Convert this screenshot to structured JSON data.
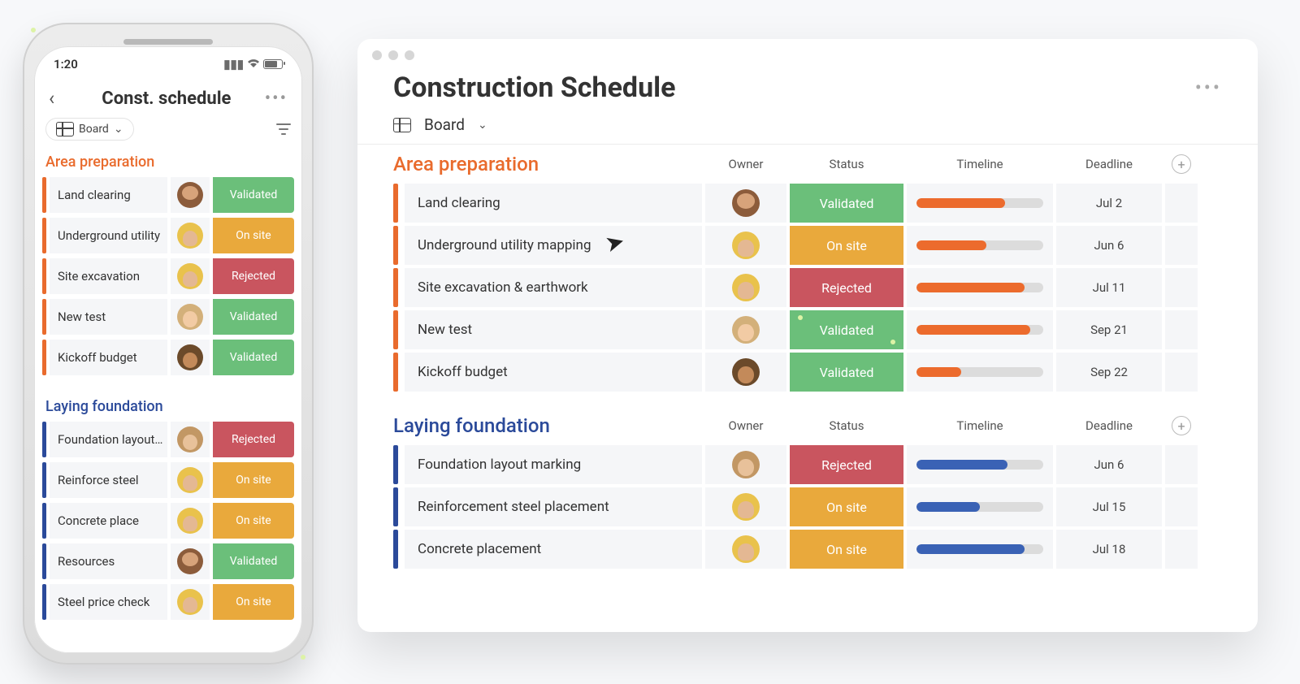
{
  "phone": {
    "time": "1:20",
    "header": {
      "title": "Const. schedule"
    },
    "view_chip": "Board",
    "groups": [
      {
        "title": "Area preparation",
        "color": "orange",
        "rows": [
          {
            "name": "Land clearing",
            "avatar": "av-1",
            "status": "Validated",
            "status_class": "st-validated"
          },
          {
            "name": "Underground utility",
            "avatar": "av-2",
            "status": "On site",
            "status_class": "st-onsite"
          },
          {
            "name": "Site excavation",
            "avatar": "av-2",
            "status": "Rejected",
            "status_class": "st-rejected"
          },
          {
            "name": "New test",
            "avatar": "av-3",
            "status": "Validated",
            "status_class": "st-validated",
            "confetti": true
          },
          {
            "name": "Kickoff budget",
            "avatar": "av-4",
            "status": "Validated",
            "status_class": "st-validated"
          }
        ]
      },
      {
        "title": "Laying foundation",
        "color": "navy",
        "rows": [
          {
            "name": "Foundation layout…",
            "avatar": "av-5",
            "status": "Rejected",
            "status_class": "st-rejected"
          },
          {
            "name": "Reinforce steel",
            "avatar": "av-2",
            "status": "On site",
            "status_class": "st-onsite"
          },
          {
            "name": "Concrete place",
            "avatar": "av-2",
            "status": "On site",
            "status_class": "st-onsite"
          },
          {
            "name": "Resources",
            "avatar": "av-1",
            "status": "Validated",
            "status_class": "st-validated"
          },
          {
            "name": "Steel price check",
            "avatar": "av-2",
            "status": "On site",
            "status_class": "st-onsite"
          }
        ]
      }
    ]
  },
  "desktop": {
    "title": "Construction Schedule",
    "view_label": "Board",
    "columns": {
      "owner": "Owner",
      "status": "Status",
      "timeline": "Timeline",
      "deadline": "Deadline"
    },
    "groups": [
      {
        "title": "Area preparation",
        "color": "orange",
        "rows": [
          {
            "name": "Land clearing",
            "avatar": "av-1",
            "status": "Validated",
            "status_class": "st-validated",
            "progress": 70,
            "fill": "orange",
            "deadline": "Jul 2"
          },
          {
            "name": "Underground utility mapping",
            "avatar": "av-2",
            "status": "On site",
            "status_class": "st-onsite",
            "progress": 55,
            "fill": "orange",
            "deadline": "Jun 6"
          },
          {
            "name": "Site excavation & earthwork",
            "avatar": "av-2",
            "status": "Rejected",
            "status_class": "st-rejected",
            "progress": 85,
            "fill": "orange",
            "deadline": "Jul 11"
          },
          {
            "name": "New test",
            "avatar": "av-3",
            "status": "Validated",
            "status_class": "st-validated",
            "progress": 90,
            "fill": "orange",
            "deadline": "Sep 21",
            "confetti": true
          },
          {
            "name": "Kickoff budget",
            "avatar": "av-4",
            "status": "Validated",
            "status_class": "st-validated",
            "progress": 35,
            "fill": "orange",
            "deadline": "Sep 22"
          }
        ]
      },
      {
        "title": "Laying foundation",
        "color": "navy",
        "rows": [
          {
            "name": "Foundation layout marking",
            "avatar": "av-5",
            "status": "Rejected",
            "status_class": "st-rejected",
            "progress": 72,
            "fill": "navy",
            "deadline": "Jun 6"
          },
          {
            "name": "Reinforcement steel placement",
            "avatar": "av-2",
            "status": "On site",
            "status_class": "st-onsite",
            "progress": 50,
            "fill": "navy",
            "deadline": "Jul 15"
          },
          {
            "name": "Concrete placement",
            "avatar": "av-2",
            "status": "On site",
            "status_class": "st-onsite",
            "progress": 85,
            "fill": "navy",
            "deadline": "Jul 18"
          }
        ]
      }
    ]
  }
}
